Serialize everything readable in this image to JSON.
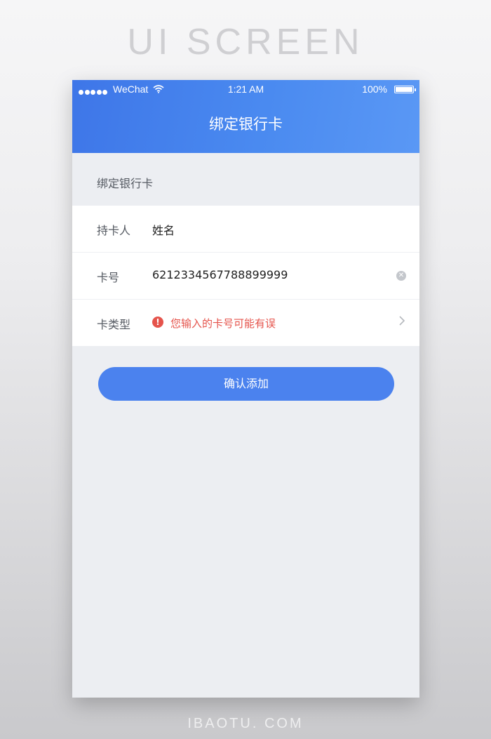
{
  "page_heading": "UI SCREEN",
  "footer_credit": "IBAOTU. COM",
  "status_bar": {
    "carrier": "WeChat",
    "time": "1:21 AM",
    "battery": "100%",
    "signal_icon": "signal-dots-icon",
    "wifi_icon": "wifi-icon",
    "battery_icon": "battery-icon"
  },
  "nav": {
    "title": "绑定银行卡"
  },
  "section": {
    "label": "绑定银行卡"
  },
  "form": {
    "holder": {
      "label": "持卡人",
      "value": "姓名"
    },
    "card_number": {
      "label": "卡号",
      "value": "6212334567788899999",
      "clear_icon": "clear-icon"
    },
    "card_type": {
      "label": "卡类型",
      "error": "您输入的卡号可能有误",
      "error_icon": "alert-icon",
      "chevron_icon": "chevron-right-icon"
    }
  },
  "confirm_button": "确认添加",
  "colors": {
    "header_blue": "#4a8af0",
    "button_blue": "#4b82ee",
    "error_red": "#e5534b",
    "background": "#eceef2"
  }
}
